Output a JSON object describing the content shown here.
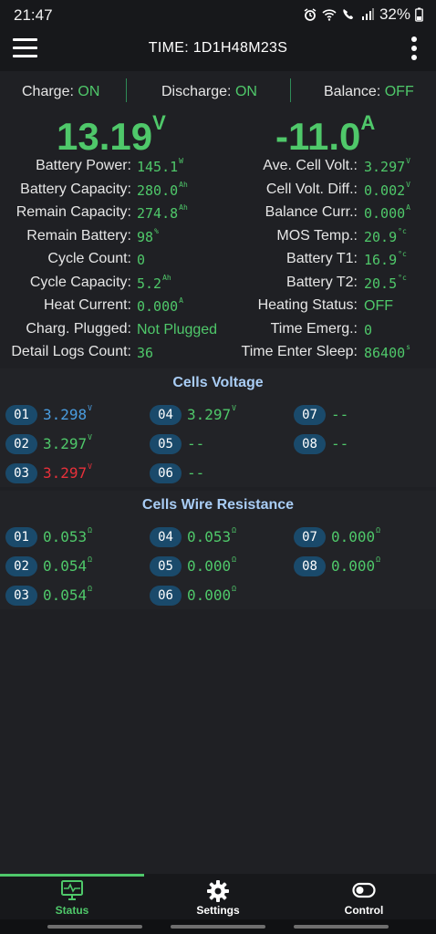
{
  "status_bar": {
    "time": "21:47",
    "battery": "32%"
  },
  "app_bar": {
    "title": "TIME: 1D1H48M23S"
  },
  "modes": [
    {
      "label": "Charge:",
      "value": "ON"
    },
    {
      "label": "Discharge:",
      "value": "ON"
    },
    {
      "label": "Balance:",
      "value": "OFF"
    }
  ],
  "voltage": {
    "value": "13.19",
    "unit": "V"
  },
  "current": {
    "value": "-11.0",
    "unit": "A"
  },
  "left_stats": [
    {
      "label": "Battery Power:",
      "value": "145.1",
      "unit": "W"
    },
    {
      "label": "Battery Capacity:",
      "value": "280.0",
      "unit": "Ah"
    },
    {
      "label": "Remain Capacity:",
      "value": "274.8",
      "unit": "Ah"
    },
    {
      "label": "Remain Battery:",
      "value": "98",
      "unit": "%"
    },
    {
      "label": "Cycle Count:",
      "value": "0",
      "unit": ""
    },
    {
      "label": "Cycle Capacity:",
      "value": "5.2",
      "unit": "Ah"
    },
    {
      "label": "Heat Current:",
      "value": "0.000",
      "unit": "A"
    },
    {
      "label": "Charg. Plugged:",
      "value": "Not Plugged",
      "unit": ""
    },
    {
      "label": "Detail Logs Count:",
      "value": "36",
      "unit": ""
    }
  ],
  "right_stats": [
    {
      "label": "Ave. Cell Volt.:",
      "value": "3.297",
      "unit": "V"
    },
    {
      "label": "Cell Volt. Diff.:",
      "value": "0.002",
      "unit": "V"
    },
    {
      "label": "Balance Curr.:",
      "value": "0.000",
      "unit": "A"
    },
    {
      "label": "MOS Temp.:",
      "value": "20.9",
      "unit": "°c"
    },
    {
      "label": "Battery T1:",
      "value": "16.9",
      "unit": "°c"
    },
    {
      "label": "Battery T2:",
      "value": "20.5",
      "unit": "°c"
    },
    {
      "label": "Heating Status:",
      "value": "OFF",
      "unit": ""
    },
    {
      "label": "Time Emerg.:",
      "value": "0",
      "unit": ""
    },
    {
      "label": "Time Enter Sleep:",
      "value": "86400",
      "unit": "s"
    }
  ],
  "cells_voltage": {
    "title": "Cells Voltage",
    "cells": [
      {
        "id": "01",
        "value": "3.298",
        "unit": "V",
        "color": "#4a9de0"
      },
      {
        "id": "02",
        "value": "3.297",
        "unit": "V",
        "color": "#4fc86a"
      },
      {
        "id": "03",
        "value": "3.297",
        "unit": "V",
        "color": "#e8303a"
      },
      {
        "id": "04",
        "value": "3.297",
        "unit": "V",
        "color": "#4fc86a"
      },
      {
        "id": "05",
        "value": "--",
        "unit": "",
        "color": "#4fc86a"
      },
      {
        "id": "06",
        "value": "--",
        "unit": "",
        "color": "#4fc86a"
      },
      {
        "id": "07",
        "value": "--",
        "unit": "",
        "color": "#4fc86a"
      },
      {
        "id": "08",
        "value": "--",
        "unit": "",
        "color": "#4fc86a"
      }
    ]
  },
  "cells_resistance": {
    "title": "Cells Wire Resistance",
    "cells": [
      {
        "id": "01",
        "value": "0.053",
        "unit": "Ω"
      },
      {
        "id": "02",
        "value": "0.054",
        "unit": "Ω"
      },
      {
        "id": "03",
        "value": "0.054",
        "unit": "Ω"
      },
      {
        "id": "04",
        "value": "0.053",
        "unit": "Ω"
      },
      {
        "id": "05",
        "value": "0.000",
        "unit": "Ω"
      },
      {
        "id": "06",
        "value": "0.000",
        "unit": "Ω"
      },
      {
        "id": "07",
        "value": "0.000",
        "unit": "Ω"
      },
      {
        "id": "08",
        "value": "0.000",
        "unit": "Ω"
      }
    ]
  },
  "bottom_nav": [
    {
      "label": "Status",
      "icon": "monitor-pulse-icon",
      "active": true
    },
    {
      "label": "Settings",
      "icon": "gear-icon",
      "active": false
    },
    {
      "label": "Control",
      "icon": "toggle-icon",
      "active": false
    }
  ],
  "colors": {
    "accent": "#4fc86a",
    "badge": "#1a4a6b",
    "section_title": "#a9cdf5"
  }
}
